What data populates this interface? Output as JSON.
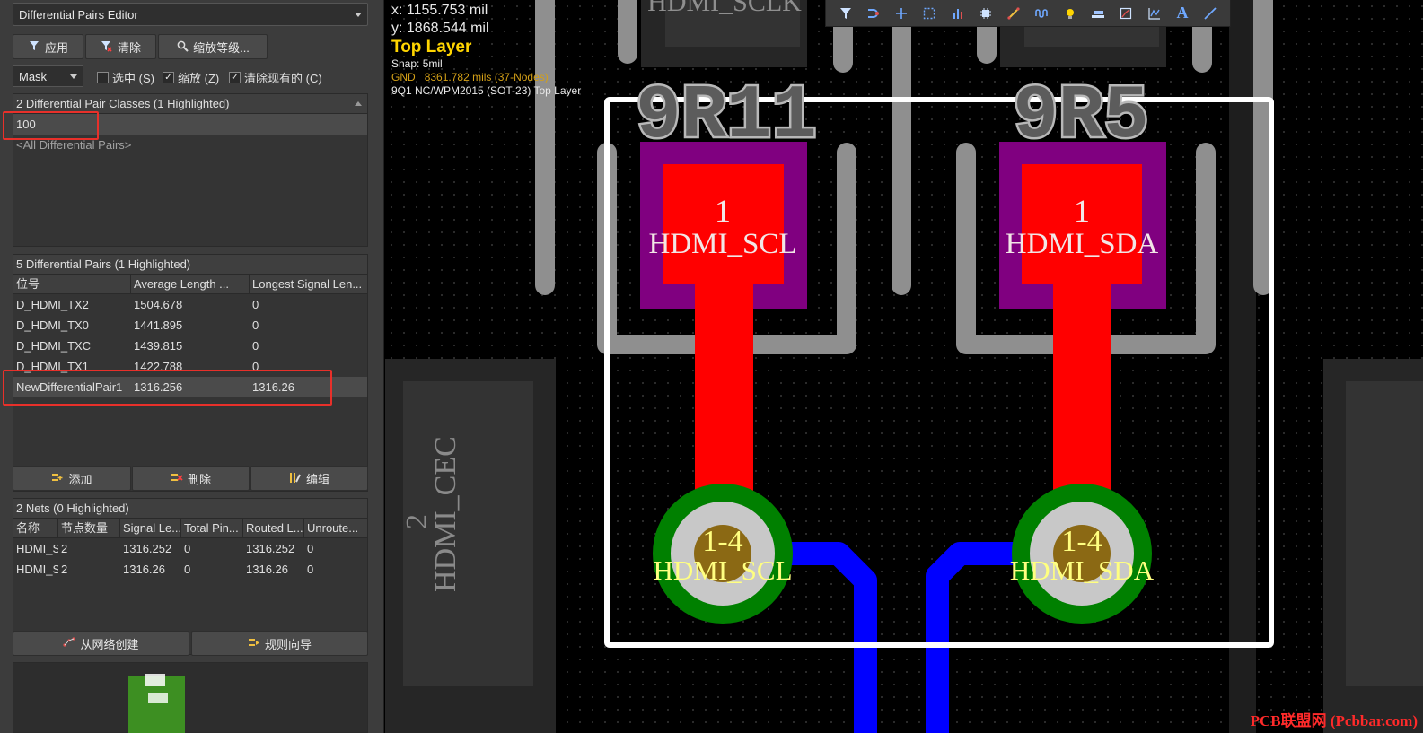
{
  "panel": {
    "title": "Differential Pairs Editor",
    "buttons": {
      "apply": "应用",
      "clear": "清除",
      "zoom": "缩放等级..."
    },
    "mask": {
      "value": "Mask"
    },
    "checkboxes": [
      {
        "label": "选中 (S)",
        "checked": false
      },
      {
        "label": "缩放 (Z)",
        "checked": true
      },
      {
        "label": "清除现有的 (C)",
        "checked": true
      }
    ],
    "classes": {
      "title": "2 Differential Pair Classes (1 Highlighted)",
      "items": [
        "100",
        "<All Differential Pairs>"
      ]
    },
    "pairs": {
      "title": "5 Differential Pairs (1 Highlighted)",
      "columns": [
        "位号",
        "Average Length ...",
        "Longest Signal Len..."
      ],
      "rows": [
        [
          "D_HDMI_TX2",
          "1504.678",
          "0"
        ],
        [
          "D_HDMI_TX0",
          "1441.895",
          "0"
        ],
        [
          "D_HDMI_TXC",
          "1439.815",
          "0"
        ],
        [
          "D_HDMI_TX1",
          "1422.788",
          "0"
        ],
        [
          "NewDifferentialPair1",
          "1316.256",
          "1316.26"
        ]
      ],
      "add": "添加",
      "delete": "删除",
      "edit": "编辑"
    },
    "nets": {
      "title": "2 Nets (0 Highlighted)",
      "columns": [
        "名称",
        "节点数量",
        "Signal Le...",
        "Total Pin...",
        "Routed L...",
        "Unroute..."
      ],
      "rows": [
        [
          "HDMI_S",
          "2",
          "1316.252",
          "0",
          "1316.252",
          "0"
        ],
        [
          "HDMI_S",
          "2",
          "1316.26",
          "0",
          "1316.26",
          "0"
        ]
      ],
      "from_nets": "从网络创建",
      "rule_wizard": "规则向导"
    }
  },
  "hud": {
    "x": "x:  1155.753 mil",
    "y": "y:  1868.544 mil",
    "layer": "Top Layer",
    "snap": "Snap: 5mil",
    "gnd_net": "GND",
    "gnd_info": "8361.782 mils (37-Nodes)",
    "component": "9Q1 NC/WPM2015 (SOT-23) Top Layer"
  },
  "board": {
    "top_label": "HDMI_SCLK",
    "designators": [
      "9R11",
      "9R5"
    ],
    "pad_left": {
      "num": "1",
      "net": "HDMI_SCL"
    },
    "pad_right": {
      "num": "1",
      "net": "HDMI_SDA"
    },
    "via_left": {
      "num": "1-4",
      "net": "HDMI_SCL"
    },
    "via_right": {
      "num": "1-4",
      "net": "HDMI_SDA"
    },
    "side_label": "HDMI_CEC",
    "side_num": "2"
  },
  "colors": {
    "pad": "#ff0000",
    "pad_mask": "#800080",
    "silkscreen": "#8f8f8f",
    "bottom_trace": "#0000ff",
    "via_ring": "#008000",
    "highlight": "#e8302a"
  },
  "toolbar_icons": [
    "filter-icon",
    "route-icon",
    "cross-icon",
    "select-rect-icon",
    "chart-icon",
    "chip-icon",
    "diff-route-icon",
    "tune-icon",
    "bulb-icon",
    "layer-icon",
    "polygon-icon",
    "graph-icon",
    "text-icon",
    "line-icon"
  ],
  "watermark": "PCB联盟网 (Pcbbar.com)"
}
